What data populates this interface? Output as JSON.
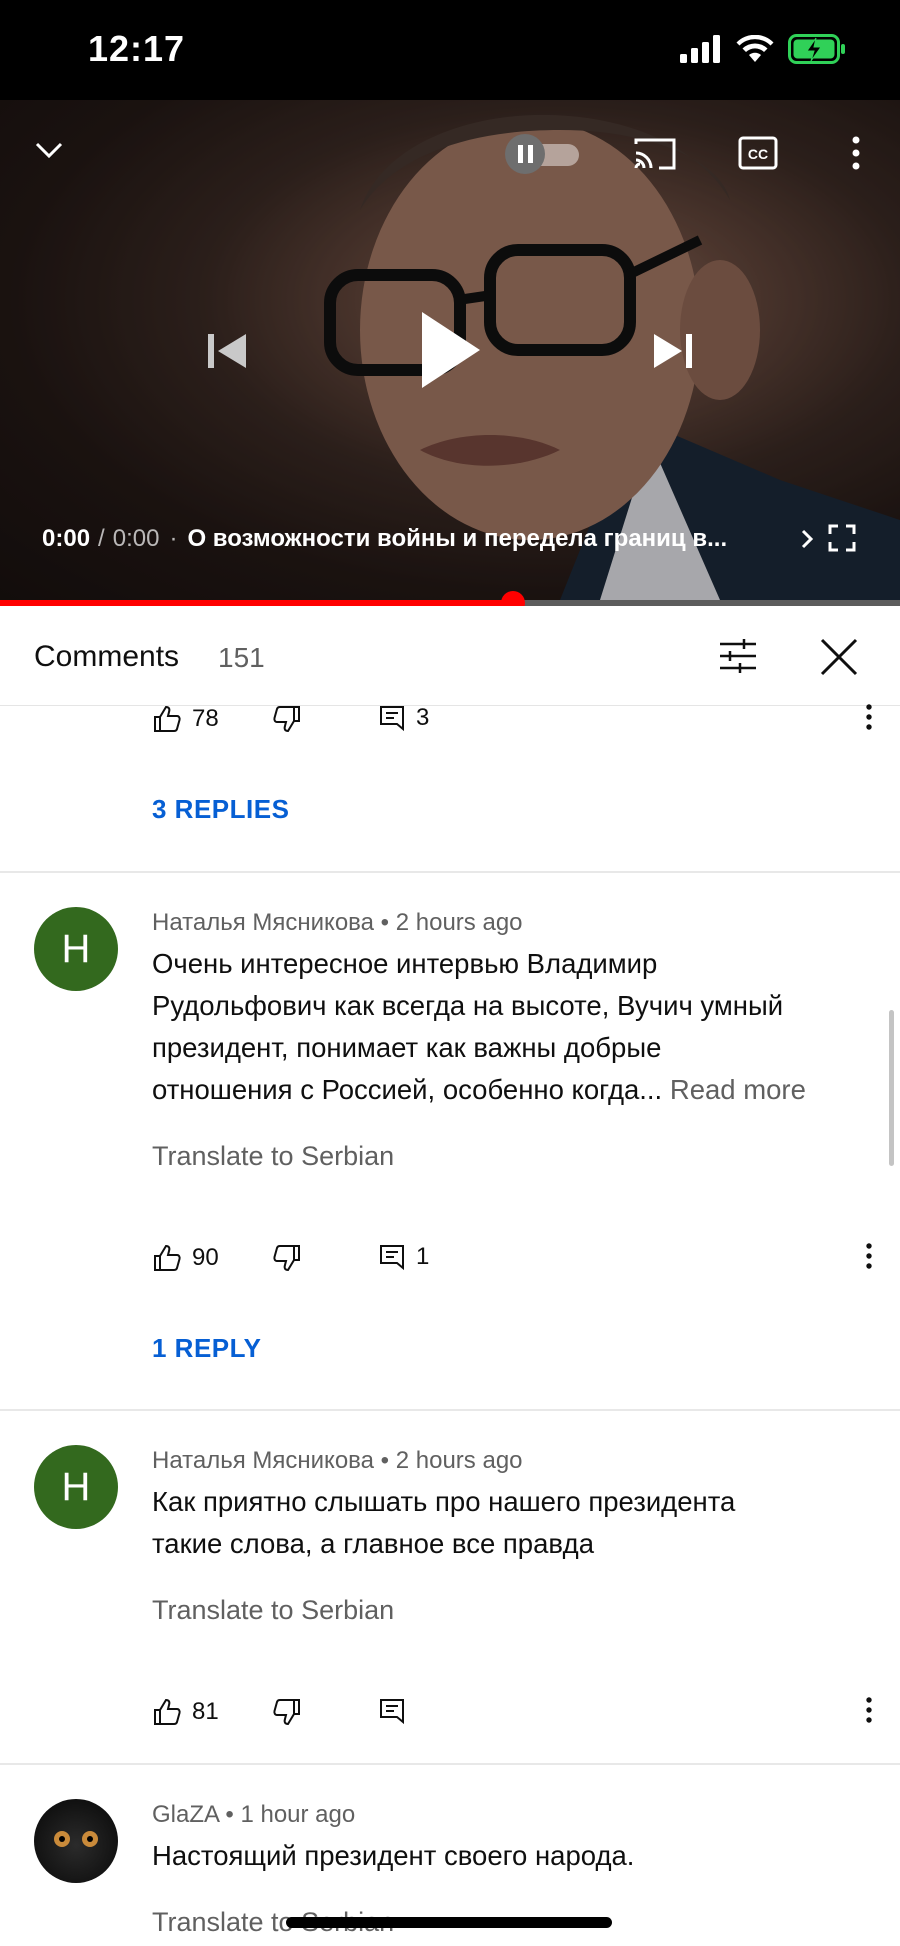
{
  "status_bar": {
    "time": "12:17"
  },
  "player": {
    "current_time": "0:00",
    "separator": "/",
    "duration": "0:00",
    "dot": "·",
    "video_title": "О возможности войны и передела границ в...",
    "progress_fraction": 0.57,
    "icons": [
      "chevron-down-icon",
      "autoplay-toggle",
      "cast-icon",
      "cc-icon",
      "more-vert-icon",
      "previous-icon",
      "play-icon",
      "next-icon",
      "chevron-right-icon",
      "fullscreen-icon"
    ]
  },
  "comments_panel": {
    "title": "Comments",
    "count": "151"
  },
  "comments": [
    {
      "likes": "78",
      "reply_count": "3",
      "replies_link": "3 REPLIES"
    },
    {
      "avatar_letter": "Н",
      "author": "Наталья Мясникова",
      "bullet": "•",
      "time": "2 hours ago",
      "text_lines": [
        "Очень интересное интервью  Владимир",
        "Рудольфович как всегда на высоте, Вучич умный",
        "президент,  понимает как важны добрые",
        "отношения с Россией, особенно когда..."
      ],
      "read_more": "Read more",
      "translate": "Translate to Serbian",
      "likes": "90",
      "reply_count": "1",
      "replies_link": "1 REPLY"
    },
    {
      "avatar_letter": "Н",
      "author": "Наталья Мясникова",
      "bullet": "•",
      "time": "2 hours ago",
      "text_lines": [
        "Как приятно слышать про нашего президента",
        "такие слова, а главное все правда"
      ],
      "translate": "Translate to Serbian",
      "likes": "81",
      "reply_count": ""
    },
    {
      "author": "GlaZA",
      "bullet": "•",
      "time": "1 hour ago",
      "text_lines": [
        "Настоящий президент своего народа."
      ],
      "translate": "Translate to Serbian"
    }
  ],
  "colors": {
    "accent_red": "#ff0000",
    "link_blue": "#065fd4",
    "avatar_green": "#33691e",
    "battery_green": "#30d158"
  }
}
